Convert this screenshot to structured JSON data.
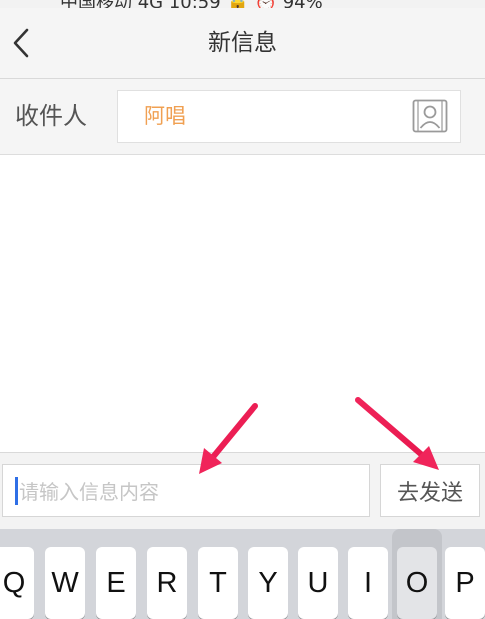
{
  "status_bar": {
    "partial_text": "中国移动  4G  10:59  🔒 ⏰ 94%"
  },
  "nav": {
    "title": "新信息",
    "back_icon": "chevron-left-icon"
  },
  "recipient": {
    "label": "收件人",
    "name": "阿唱",
    "contact_icon": "contact-card-icon",
    "name_color": "#f0a052"
  },
  "compose": {
    "placeholder": "请输入信息内容",
    "send_label": "去发送",
    "caret_color": "#2f6fe6"
  },
  "keyboard": {
    "keys": [
      "Q",
      "W",
      "E",
      "R",
      "T",
      "Y",
      "U",
      "I",
      "O",
      "P"
    ],
    "pressed_key": "O"
  },
  "annotations": {
    "arrow_color": "#f0245a",
    "arrow_count": 2
  }
}
